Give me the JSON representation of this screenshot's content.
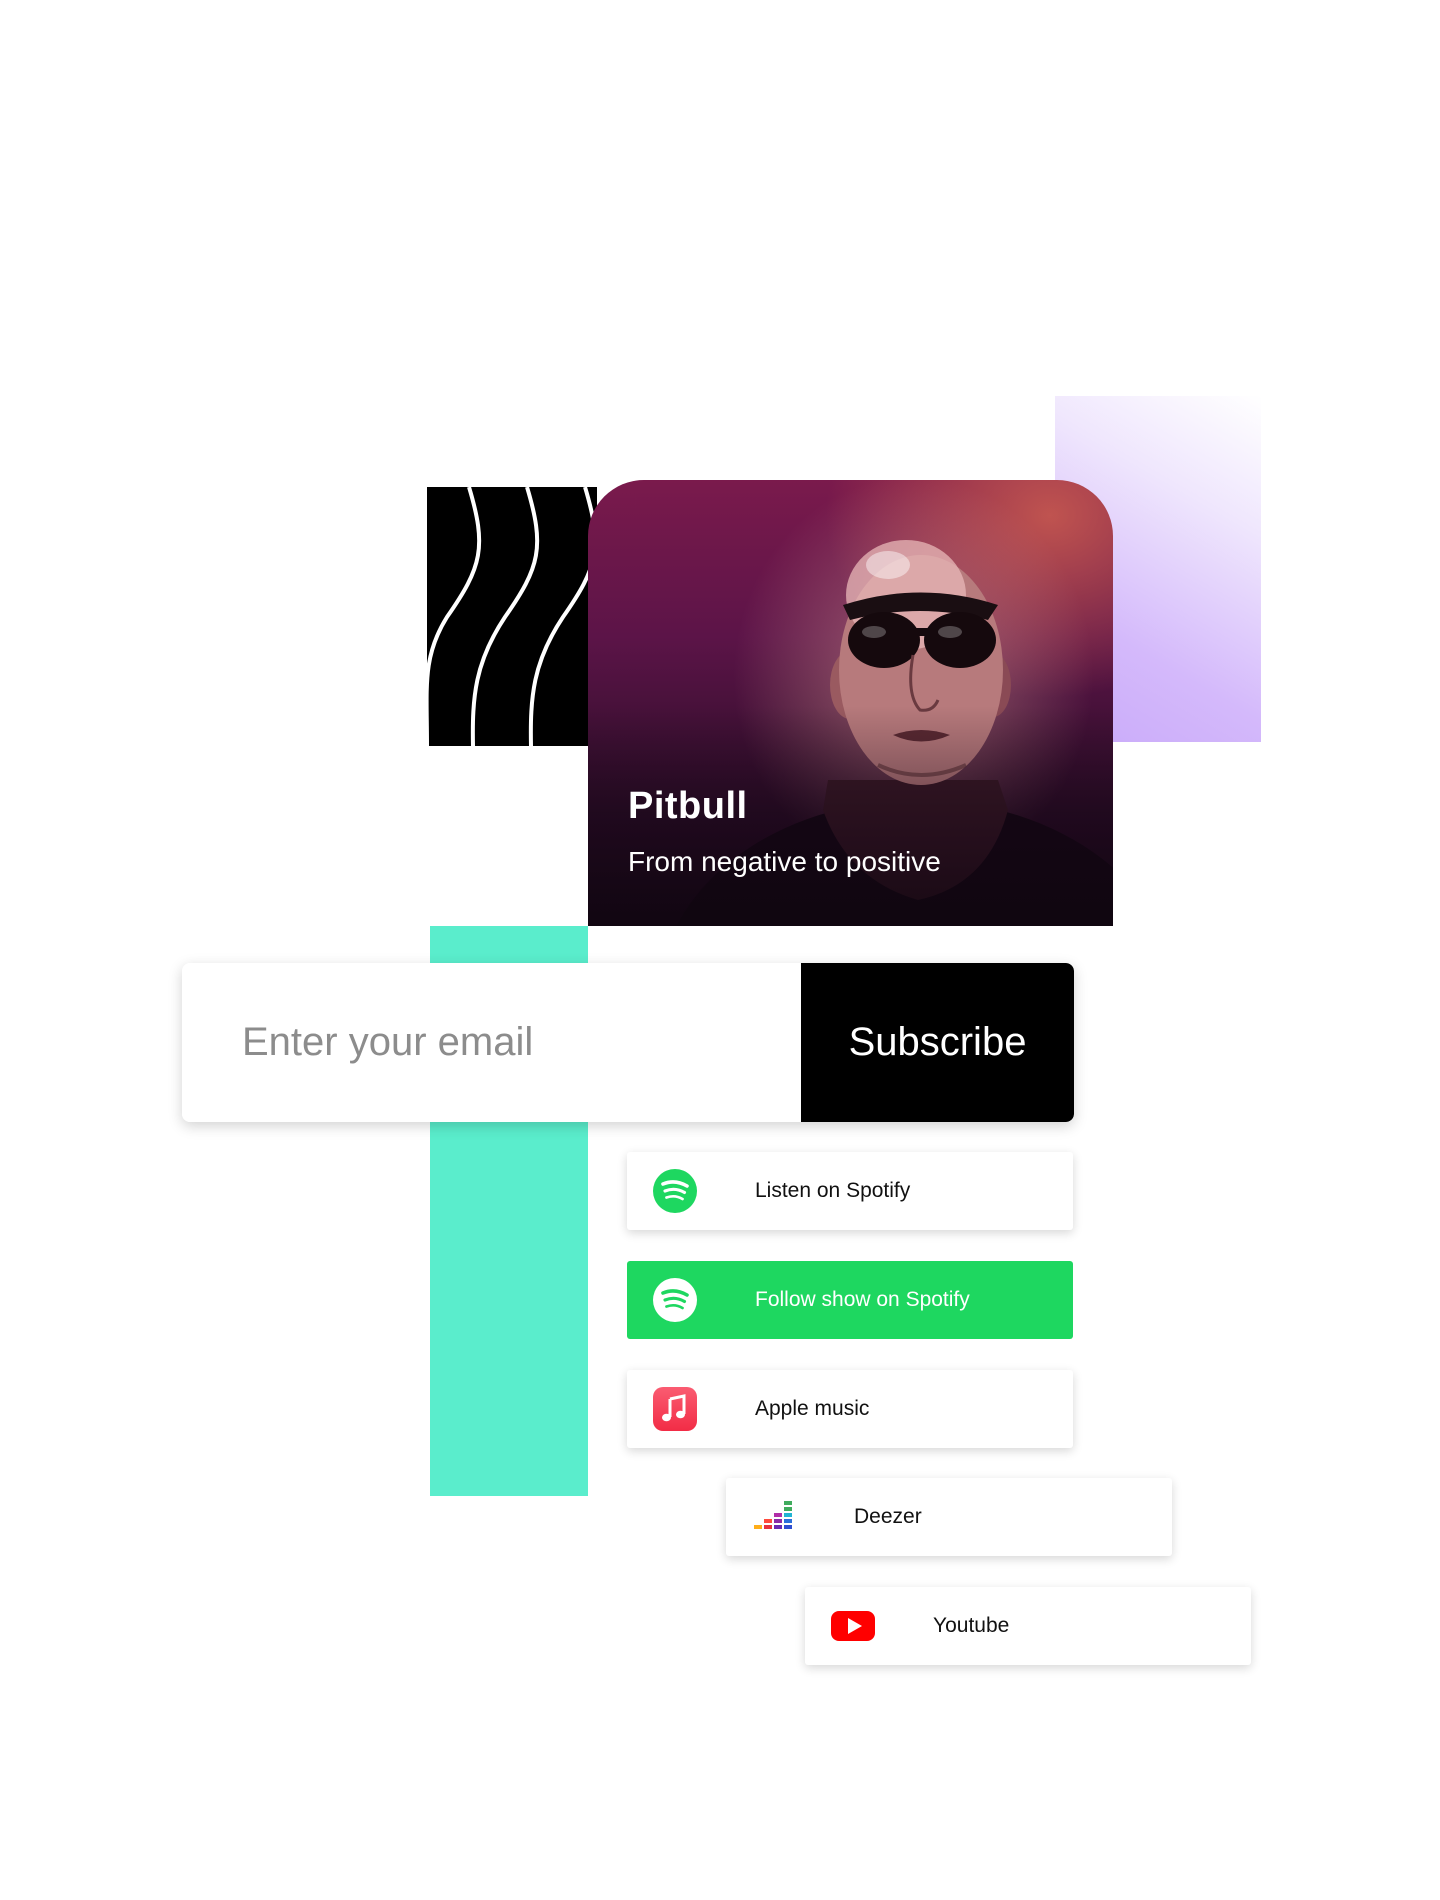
{
  "artist": {
    "name": "Pitbull",
    "tagline": "From negative to positive"
  },
  "subscribe": {
    "placeholder": "Enter your email",
    "button_label": "Subscribe"
  },
  "platforms": [
    {
      "label": "Listen on Spotify",
      "icon": "spotify-icon"
    },
    {
      "label": "Follow show on Spotify",
      "icon": "spotify-icon",
      "highlighted": true
    },
    {
      "label": "Apple music",
      "icon": "apple-music-icon"
    },
    {
      "label": "Deezer",
      "icon": "deezer-icon"
    },
    {
      "label": "Youtube",
      "icon": "youtube-icon"
    }
  ],
  "colors": {
    "spotify_green": "#1ed760",
    "teal_accent": "#5aedcc",
    "purple_accent": "#c9aaf9",
    "youtube_red": "#ff0000",
    "apple_music_pink": "#fa3d5a"
  }
}
